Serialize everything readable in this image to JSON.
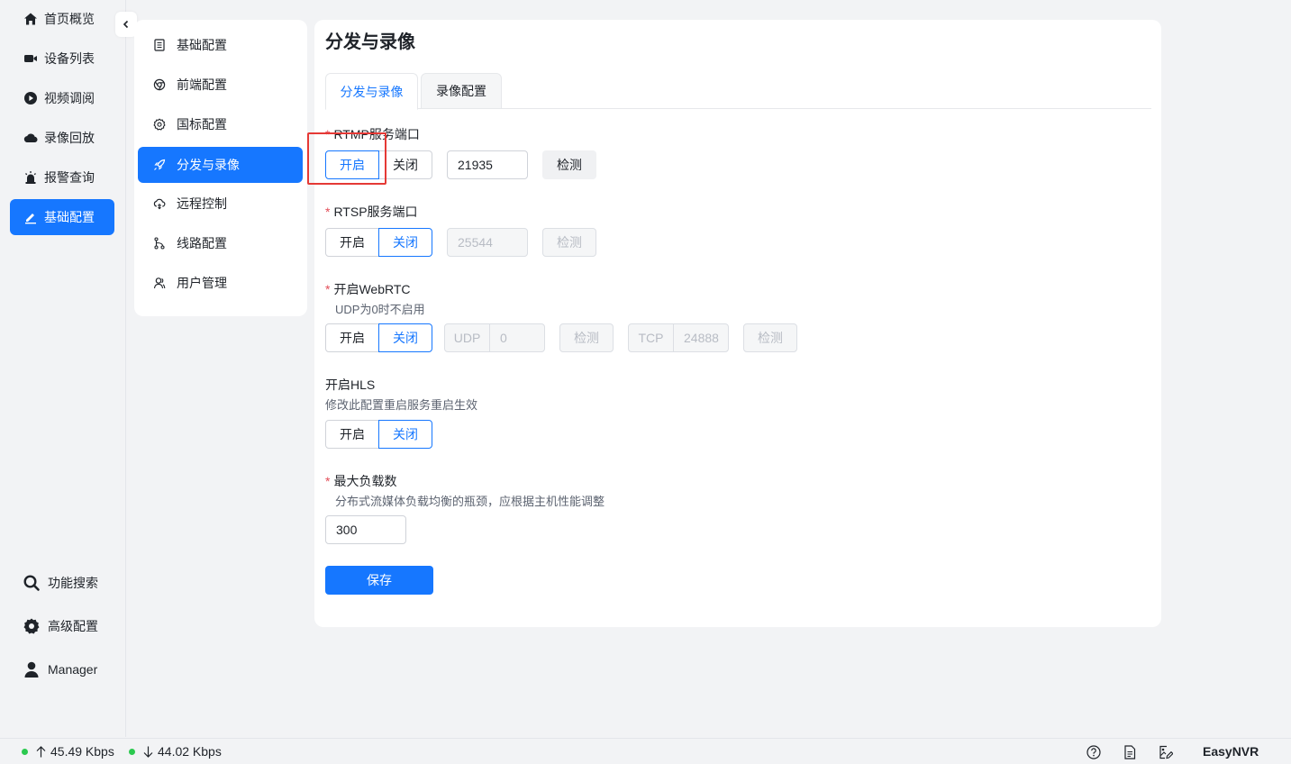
{
  "nav": {
    "items": [
      {
        "label": "首页概览",
        "icon": "home-icon"
      },
      {
        "label": "设备列表",
        "icon": "camera-icon"
      },
      {
        "label": "视频调阅",
        "icon": "play-circle-icon"
      },
      {
        "label": "录像回放",
        "icon": "cloud-icon"
      },
      {
        "label": "报警查询",
        "icon": "alarm-light-icon"
      },
      {
        "label": "基础配置",
        "icon": "edit-icon",
        "active": true
      }
    ],
    "bottom": [
      {
        "label": "功能搜索",
        "icon": "search-icon"
      },
      {
        "label": "高级配置",
        "icon": "gear-icon"
      },
      {
        "label": "Manager",
        "icon": "user-icon"
      }
    ]
  },
  "submenu": {
    "items": [
      {
        "label": "基础配置",
        "icon": "document-icon"
      },
      {
        "label": "前端配置",
        "icon": "chrome-icon"
      },
      {
        "label": "国标配置",
        "icon": "settings-icon"
      },
      {
        "label": "分发与录像",
        "icon": "rocket-icon",
        "active": true
      },
      {
        "label": "远程控制",
        "icon": "cloud-remote-icon"
      },
      {
        "label": "线路配置",
        "icon": "route-icon"
      },
      {
        "label": "用户管理",
        "icon": "users-icon"
      }
    ]
  },
  "page": {
    "title": "分发与录像",
    "tabs": [
      {
        "label": "分发与录像",
        "active": true
      },
      {
        "label": "录像配置"
      }
    ]
  },
  "form": {
    "on_label": "开启",
    "off_label": "关闭",
    "check_label": "检测",
    "rtmp": {
      "label": "RTMP服务端口",
      "required": true,
      "state": "on",
      "port": "21935"
    },
    "rtsp": {
      "label": "RTSP服务端口",
      "required": true,
      "state": "off",
      "port": "25544"
    },
    "webrtc": {
      "label": "开启WebRTC",
      "required": true,
      "hint": "UDP为0时不启用",
      "state": "off",
      "udp_prefix": "UDP",
      "udp_value": "0",
      "tcp_prefix": "TCP",
      "tcp_value": "24888"
    },
    "hls": {
      "label": "开启HLS",
      "required": false,
      "hint": "修改此配置重启服务重启生效",
      "state": "off"
    },
    "max_load": {
      "label": "最大负载数",
      "required": true,
      "hint": "分布式流媒体负载均衡的瓶颈，应根据主机性能调整",
      "value": "300"
    },
    "save_label": "保存"
  },
  "statusbar": {
    "upload": "45.49 Kbps",
    "download": "44.02 Kbps",
    "brand": "EasyNVR",
    "icons": [
      "help-icon",
      "doc-icon",
      "image-edit-icon"
    ],
    "status_color": "#2bc94f"
  },
  "colors": {
    "accent": "#1677ff",
    "highlight": "#e53935"
  }
}
